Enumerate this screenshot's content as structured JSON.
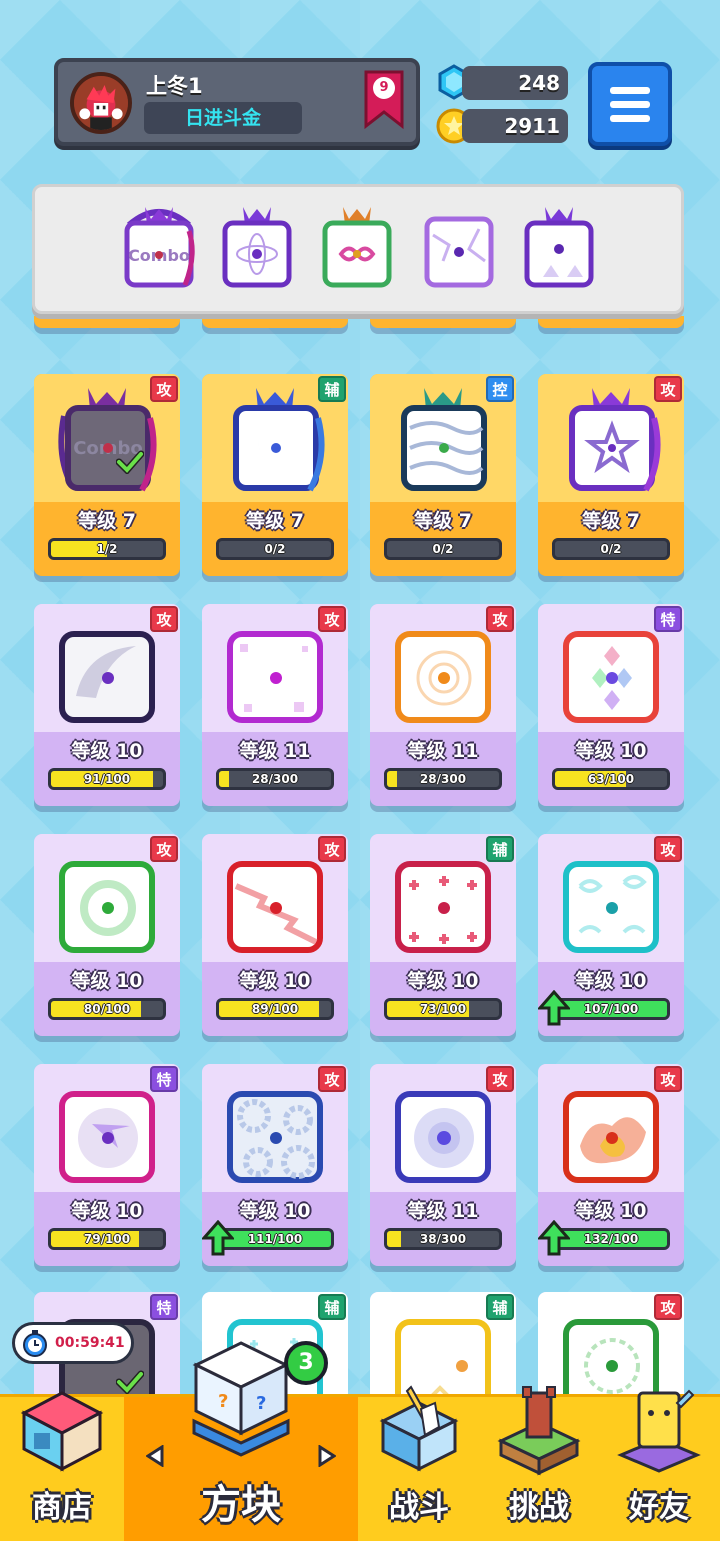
{
  "player": {
    "name": "上冬1",
    "title": "日进斗金",
    "rank": "9"
  },
  "currency": {
    "gems": "248",
    "coins": "2911"
  },
  "colors": {
    "attack_tag": "#e8394a",
    "support_tag": "#1fa36e",
    "control_tag": "#2f8ef0",
    "special_tag": "#8b4fe0",
    "bar_fill": "#f7e320",
    "bar_full": "#3fe05c",
    "nav_bg": "#ffcc1e"
  },
  "equipped": {
    "slots": [
      {
        "icon": "combo-dice-icon",
        "text": "Combo"
      },
      {
        "icon": "orbit-dice-icon"
      },
      {
        "icon": "infinity-dice-icon"
      },
      {
        "icon": "crack-dice-icon"
      },
      {
        "icon": "triangle-dice-icon"
      }
    ]
  },
  "cards": [
    {
      "tag": "攻",
      "tag_type": "atk",
      "level": "等级 7",
      "progress": "1/2",
      "fill": 0.5,
      "full": false,
      "rarity": "gold",
      "icon": "combo-dice-icon",
      "icon_text": "Combo",
      "checked": true
    },
    {
      "tag": "辅",
      "tag_type": "sup",
      "level": "等级 7",
      "progress": "0/2",
      "fill": 0,
      "full": false,
      "rarity": "gold",
      "icon": "moon-dice-icon"
    },
    {
      "tag": "控",
      "tag_type": "ctl",
      "level": "等级 7",
      "progress": "0/2",
      "fill": 0,
      "full": false,
      "rarity": "gold",
      "icon": "wind-dice-icon"
    },
    {
      "tag": "攻",
      "tag_type": "atk",
      "level": "等级 7",
      "progress": "0/2",
      "fill": 0,
      "full": false,
      "rarity": "gold",
      "icon": "star-dice-icon"
    },
    {
      "tag": "攻",
      "tag_type": "atk",
      "level": "等级 10",
      "progress": "91/100",
      "fill": 0.91,
      "full": false,
      "rarity": "purple",
      "icon": "scythe-dice-icon"
    },
    {
      "tag": "攻",
      "tag_type": "atk",
      "level": "等级 11",
      "progress": "28/300",
      "fill": 0.093,
      "full": false,
      "rarity": "purple",
      "icon": "pixel-dice-icon"
    },
    {
      "tag": "攻",
      "tag_type": "atk",
      "level": "等级 11",
      "progress": "28/300",
      "fill": 0.093,
      "full": false,
      "rarity": "purple",
      "icon": "target-dice-icon"
    },
    {
      "tag": "特",
      "tag_type": "spc",
      "level": "等级 10",
      "progress": "63/100",
      "fill": 0.63,
      "full": false,
      "rarity": "purple",
      "icon": "rainbow-dice-icon"
    },
    {
      "tag": "攻",
      "tag_type": "atk",
      "level": "等级 10",
      "progress": "80/100",
      "fill": 0.8,
      "full": false,
      "rarity": "purple",
      "icon": "biohazard-dice-icon"
    },
    {
      "tag": "攻",
      "tag_type": "atk",
      "level": "等级 10",
      "progress": "89/100",
      "fill": 0.89,
      "full": false,
      "rarity": "purple",
      "icon": "lightning-dice-icon"
    },
    {
      "tag": "辅",
      "tag_type": "sup",
      "level": "等级 10",
      "progress": "73/100",
      "fill": 0.73,
      "full": false,
      "rarity": "purple",
      "icon": "cross-dice-icon"
    },
    {
      "tag": "攻",
      "tag_type": "atk",
      "level": "等级 10",
      "progress": "107/100",
      "fill": 1,
      "full": true,
      "rarity": "purple",
      "icon": "swirl-dice-icon"
    },
    {
      "tag": "特",
      "tag_type": "spc",
      "level": "等级 10",
      "progress": "79/100",
      "fill": 0.79,
      "full": false,
      "rarity": "purple",
      "icon": "arrow-dice-icon"
    },
    {
      "tag": "攻",
      "tag_type": "atk",
      "level": "等级 10",
      "progress": "111/100",
      "fill": 1,
      "full": true,
      "rarity": "purple",
      "icon": "gear-dice-icon"
    },
    {
      "tag": "攻",
      "tag_type": "atk",
      "level": "等级 11",
      "progress": "38/300",
      "fill": 0.127,
      "full": false,
      "rarity": "purple",
      "icon": "orb-dice-icon"
    },
    {
      "tag": "攻",
      "tag_type": "atk",
      "level": "等级 10",
      "progress": "132/100",
      "fill": 1,
      "full": true,
      "rarity": "purple",
      "icon": "fire-dice-icon"
    },
    {
      "tag": "特",
      "tag_type": "spc",
      "rarity": "purple",
      "icon": "dark-dice-icon",
      "checked": true
    },
    {
      "tag": "辅",
      "tag_type": "sup",
      "rarity": "purple",
      "icon": "ice-dice-icon"
    },
    {
      "tag": "辅",
      "tag_type": "sup",
      "rarity": "purple",
      "icon": "light-dice-icon"
    },
    {
      "tag": "攻",
      "tag_type": "atk",
      "rarity": "purple",
      "icon": "thorn-dice-icon"
    }
  ],
  "timer": "00:59:41",
  "nav": {
    "shop": "商店",
    "blocks": "方块",
    "blocks_badge": "3",
    "battle": "战斗",
    "challenge": "挑战",
    "friends": "好友"
  }
}
